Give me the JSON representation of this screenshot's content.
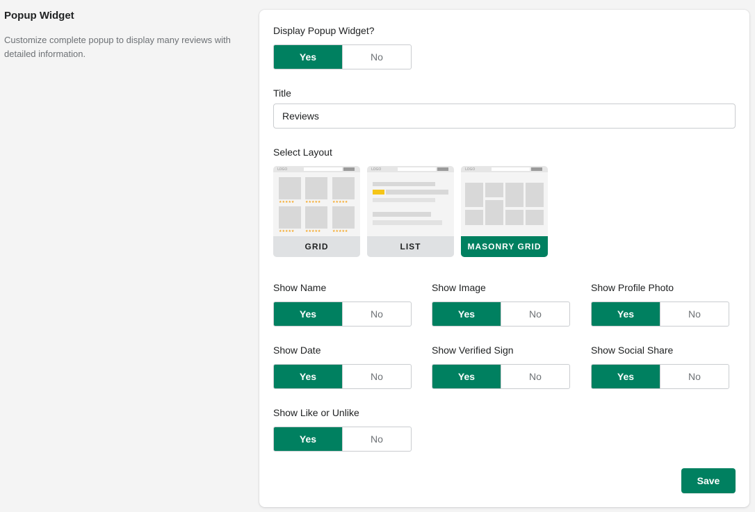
{
  "section": {
    "title": "Popup Widget",
    "description": "Customize complete popup to display many reviews with detailed information."
  },
  "display_popup": {
    "label": "Display Popup Widget?",
    "yes": "Yes",
    "no": "No",
    "value": "Yes"
  },
  "title_field": {
    "label": "Title",
    "value": "Reviews"
  },
  "layout": {
    "label": "Select Layout",
    "options": [
      {
        "caption": "GRID",
        "logo": "LOGO"
      },
      {
        "caption": "LIST",
        "logo": "LOGO"
      },
      {
        "caption": "MASONRY GRID",
        "logo": "LOGO"
      }
    ],
    "selected": "MASONRY GRID"
  },
  "toggles": [
    {
      "label": "Show Name",
      "yes": "Yes",
      "no": "No",
      "value": "Yes"
    },
    {
      "label": "Show Image",
      "yes": "Yes",
      "no": "No",
      "value": "Yes"
    },
    {
      "label": "Show Profile Photo",
      "yes": "Yes",
      "no": "No",
      "value": "Yes"
    },
    {
      "label": "Show Date",
      "yes": "Yes",
      "no": "No",
      "value": "Yes"
    },
    {
      "label": "Show Verified Sign",
      "yes": "Yes",
      "no": "No",
      "value": "Yes"
    },
    {
      "label": "Show Social Share",
      "yes": "Yes",
      "no": "No",
      "value": "Yes"
    },
    {
      "label": "Show Like or Unlike",
      "yes": "Yes",
      "no": "No",
      "value": "Yes"
    }
  ],
  "save_label": "Save",
  "colors": {
    "accent": "#008060",
    "background": "#f4f4f4",
    "star": "#f5a623"
  }
}
